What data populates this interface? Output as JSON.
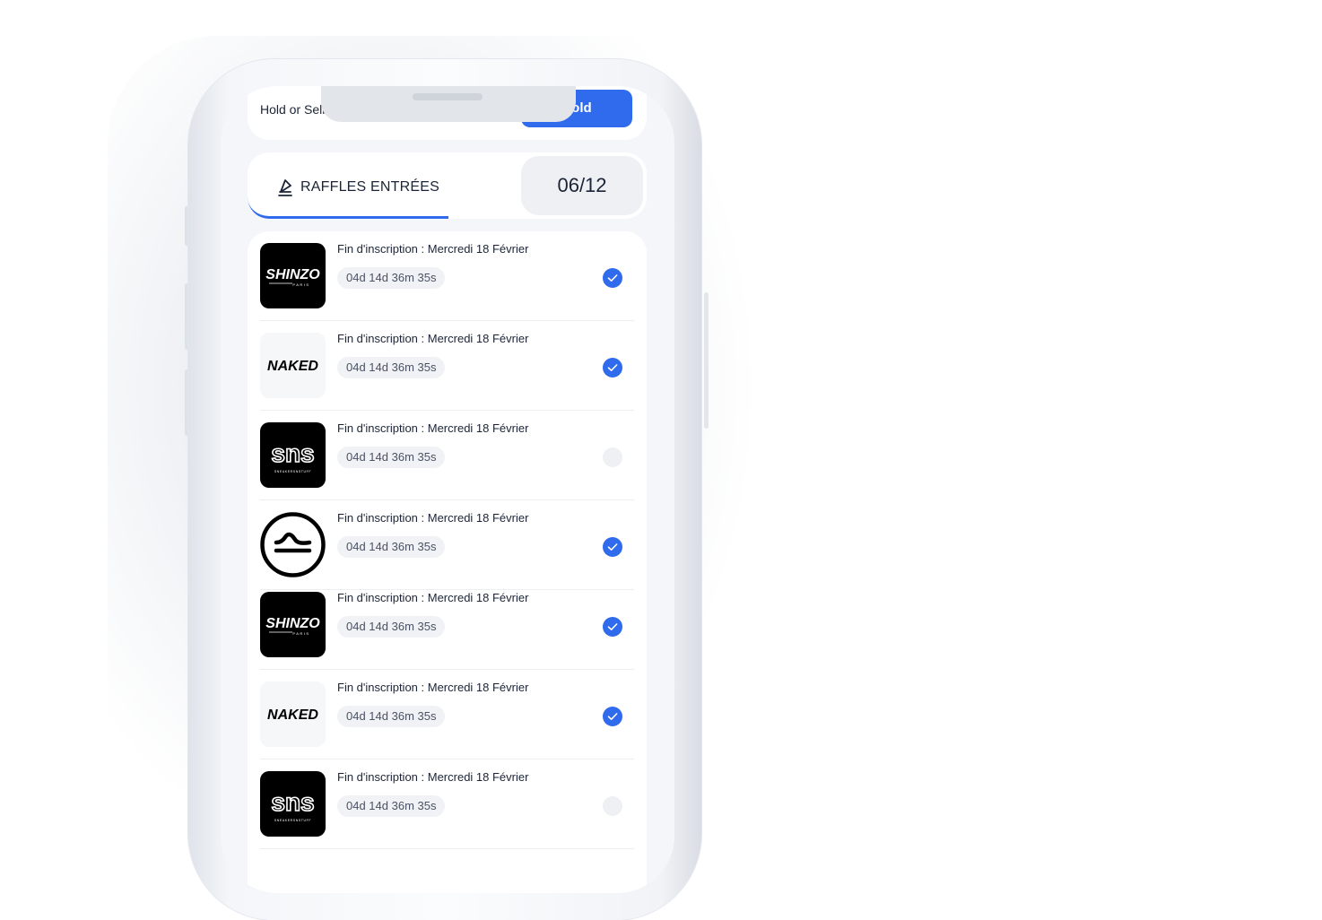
{
  "header": {
    "hold_label": "Hold or Sell .",
    "hold_button": "Hold"
  },
  "tabs": {
    "raffles_label": "RAFFLES ENTRÉES",
    "counter": "06/12"
  },
  "raffles": [
    {
      "title": "Fin d'inscription : Mercredi 18 Février",
      "timer": "04d 14d 36m 35s",
      "logo": "SHINZO",
      "logo_sub": "PARIS",
      "checked": true
    },
    {
      "title": "Fin d'inscription : Mercredi 18 Février",
      "timer": "04d 14d 36m 35s",
      "logo": "NAKED",
      "checked": true
    },
    {
      "title": "Fin d'inscription : Mercredi 18 Février",
      "timer": "04d 14d 36m 35s",
      "logo": "SNS",
      "logo_sub": "SNEAKERSNSTUFF",
      "checked": false
    },
    {
      "title": "Fin d'inscription : Mercredi 18 Février",
      "timer": "04d 14d 36m 35s",
      "logo": "circle-logo",
      "checked": true
    },
    {
      "title": "Fin d'inscription : Mercredi 18 Février",
      "timer": "04d 14d 36m 35s",
      "logo": "SHINZO",
      "logo_sub": "PARIS",
      "checked": true
    },
    {
      "title": "Fin d'inscription : Mercredi 18 Février",
      "timer": "04d 14d 36m 35s",
      "logo": "NAKED",
      "checked": true
    },
    {
      "title": "Fin d'inscription : Mercredi 18 Février",
      "timer": "04d 14d 36m 35s",
      "logo": "SNS",
      "logo_sub": "SNEAKERSNSTUFF",
      "checked": false
    }
  ],
  "colors": {
    "accent": "#2f6bec",
    "text": "#1b2437"
  }
}
